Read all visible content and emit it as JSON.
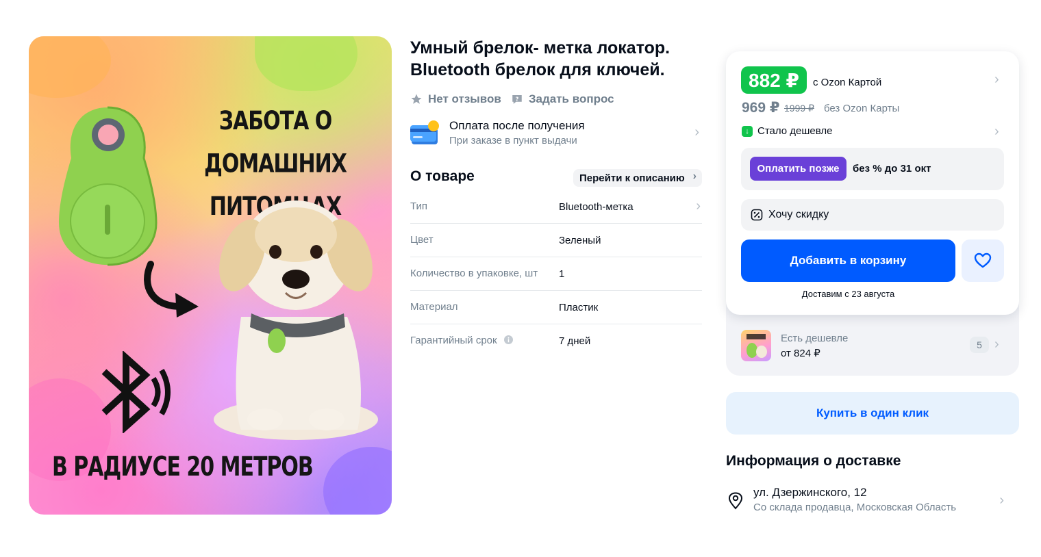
{
  "product": {
    "title": "Умный брелок- метка локатор. Bluetooth брелок для ключей.",
    "image_text": {
      "headline_line1": "ЗАБОТА О ДОМАШНИХ",
      "headline_line2": "ПИТОМЦАХ",
      "radius": "В РАДИУСЕ 20 МЕТРОВ"
    },
    "reviews_label": "Нет отзывов",
    "ask_label": "Задать вопрос",
    "pay_after": {
      "title": "Оплата после получения",
      "subtitle": "При заказе в пункт выдачи"
    }
  },
  "about": {
    "heading": "О товаре",
    "goto_label": "Перейти к описанию",
    "specs": [
      {
        "key": "Тип",
        "value": "Bluetooth-метка"
      },
      {
        "key": "Цвет",
        "value": "Зеленый"
      },
      {
        "key": "Количество в упаковке, шт",
        "value": "1"
      },
      {
        "key": "Материал",
        "value": "Пластик"
      },
      {
        "key": "Гарантийный срок",
        "value": "7 дней"
      }
    ]
  },
  "buy": {
    "card_price": "882 ₽",
    "card_price_label": "с Ozon Картой",
    "regular_price": "969 ₽",
    "old_price": "1999 ₽",
    "no_card_label": "без Ozon Карты",
    "cheaper_label": "Стало дешевле",
    "pay_later_button": "Оплатить позже",
    "pay_later_text": "без % до 31 окт",
    "discount_label": "Хочу скидку",
    "add_to_cart": "Добавить в корзину",
    "delivery_date": "Доставим с 23 августа",
    "cheaper_offer": {
      "title": "Есть дешевле",
      "price": "от 824 ₽",
      "count": "5"
    },
    "one_click": "Купить в один клик"
  },
  "delivery": {
    "heading": "Информация о доставке",
    "address": "ул. Дзержинского, 12",
    "source": "Со склада продавца, Московская Область"
  },
  "colors": {
    "accent_blue": "#005bff",
    "price_green": "#10c44c",
    "pay_later_purple": "#6a40d8"
  }
}
